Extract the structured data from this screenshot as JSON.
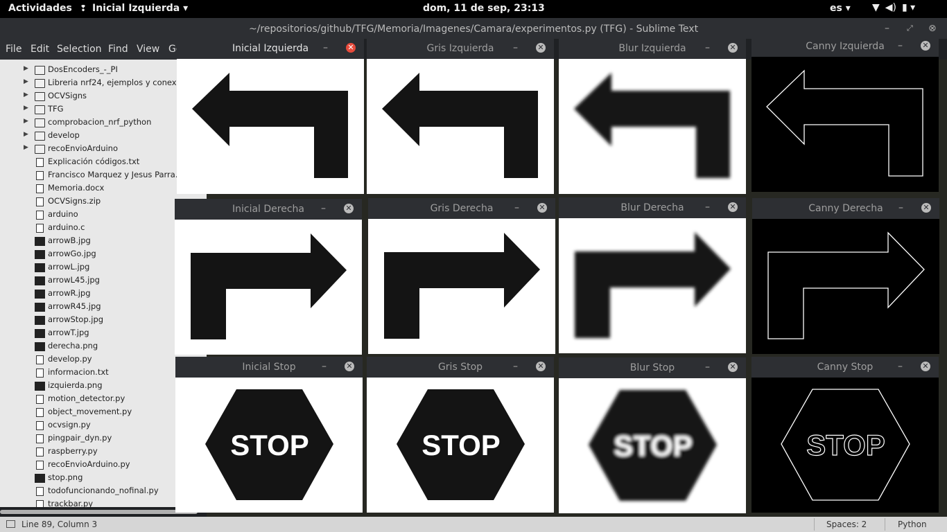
{
  "topbar": {
    "activities": "Actividades",
    "app_name": "Inicial Izquierda",
    "app_menu_arrow": "▾",
    "clock": "dom, 11 de sep, 23:13",
    "language": "es ▾",
    "status_icons": [
      "wifi-icon",
      "volume-icon",
      "battery-icon"
    ]
  },
  "sublime": {
    "title": "~/repositorios/github/TFG/Memoria/Imagenes/Camara/experimentos.py (TFG) - Sublime Text",
    "menu": [
      "File",
      "Edit",
      "Selection",
      "Find",
      "View",
      "Go"
    ],
    "sidebar": [
      {
        "type": "folder",
        "label": "DosEncoders_-_PI"
      },
      {
        "type": "folder",
        "label": "Libreria nrf24, ejemplos y conex"
      },
      {
        "type": "folder",
        "label": "OCVSigns"
      },
      {
        "type": "folder",
        "label": "TFG"
      },
      {
        "type": "folder",
        "label": "comprobacion_nrf_python"
      },
      {
        "type": "folder",
        "label": "develop"
      },
      {
        "type": "folder",
        "label": "recoEnvioArduino"
      },
      {
        "type": "file",
        "label": "Explicación códigos.txt"
      },
      {
        "type": "file",
        "label": "Francisco Marquez y Jesus Parra."
      },
      {
        "type": "file",
        "label": "Memoria.docx"
      },
      {
        "type": "file",
        "label": "OCVSigns.zip"
      },
      {
        "type": "file",
        "label": "arduino"
      },
      {
        "type": "file",
        "label": "arduino.c"
      },
      {
        "type": "image",
        "label": "arrowB.jpg"
      },
      {
        "type": "image",
        "label": "arrowGo.jpg"
      },
      {
        "type": "image",
        "label": "arrowL.jpg"
      },
      {
        "type": "image",
        "label": "arrowL45.jpg"
      },
      {
        "type": "image",
        "label": "arrowR.jpg"
      },
      {
        "type": "image",
        "label": "arrowR45.jpg"
      },
      {
        "type": "image",
        "label": "arrowStop.jpg"
      },
      {
        "type": "image",
        "label": "arrowT.jpg"
      },
      {
        "type": "image",
        "label": "derecha.png"
      },
      {
        "type": "file",
        "label": "develop.py"
      },
      {
        "type": "file",
        "label": "informacion.txt"
      },
      {
        "type": "image",
        "label": "izquierda.png"
      },
      {
        "type": "file",
        "label": "motion_detector.py"
      },
      {
        "type": "file",
        "label": "object_movement.py"
      },
      {
        "type": "file",
        "label": "ocvsign.py"
      },
      {
        "type": "file",
        "label": "pingpair_dyn.py"
      },
      {
        "type": "file",
        "label": "raspberry.py"
      },
      {
        "type": "file",
        "label": "recoEnvioArduino.py"
      },
      {
        "type": "image",
        "label": "stop.png"
      },
      {
        "type": "file",
        "label": "todofuncionando_nofinal.py"
      },
      {
        "type": "file",
        "label": "trackbar.py"
      }
    ],
    "status": {
      "position": "Line 89, Column 3",
      "spaces": "Spaces: 2",
      "syntax": "Python"
    }
  },
  "windows": {
    "inicial_izquierda": "Inicial Izquierda",
    "gris_izquierda": "Gris Izquierda",
    "blur_izquierda": "Blur Izquierda",
    "canny_izquierda": "Canny Izquierda",
    "inicial_derecha": "Inicial Derecha",
    "gris_derecha": "Gris Derecha",
    "blur_derecha": "Blur Derecha",
    "canny_derecha": "Canny Derecha",
    "inicial_stop": "Inicial Stop",
    "gris_stop": "Gris Stop",
    "blur_stop": "Blur Stop",
    "canny_stop": "Canny Stop",
    "stop_text": "STOP",
    "minimize": "–",
    "close": "✕"
  }
}
